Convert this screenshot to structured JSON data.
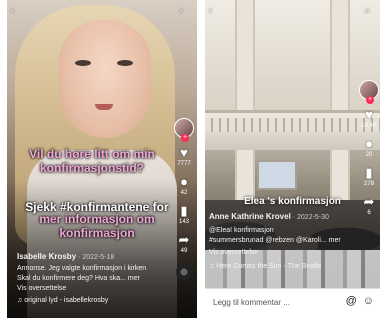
{
  "left_post": {
    "caption_line1": "Vil du høre litt om min konfirmasjonstid?",
    "caption_line2": "Sjekk #konfirmantene for",
    "caption_line3": "mer informasjon om konfirmasjon",
    "username": "Isabelle Krosby",
    "date": "· 2022-5-18",
    "desc_line1": "Annonse. Jeg valgte konfirmasjon i kirken",
    "desc_line2": "Skal du konfirmere deg? Hva ska... mer",
    "translate": "Vis oversettelse",
    "sound": "original lyd - isabellekrosby",
    "rail": {
      "likes": "7777",
      "comments": "42",
      "saves": "143",
      "shares": "49"
    }
  },
  "right_post": {
    "video_title": "Elea 's konfirmasjon",
    "username": "Anne Kathrine Krovel",
    "date": "· 2022-5-30",
    "desc_line1": "@Elea! konfirmasjon",
    "desc_line2": "#summersbrunad @rebzen @Karoli... mer",
    "translate": "Vis oversettelse",
    "sound": "Here Comes the Sun - The Beatle",
    "rail": {
      "likes": "10,4K",
      "comments": "20",
      "saves": "278",
      "shares": "6"
    },
    "comment_placeholder": "Legg til kommentar ..."
  },
  "colors": {
    "accent_pink": "#f2a6d6",
    "tiktok_red": "#fe2c55"
  }
}
